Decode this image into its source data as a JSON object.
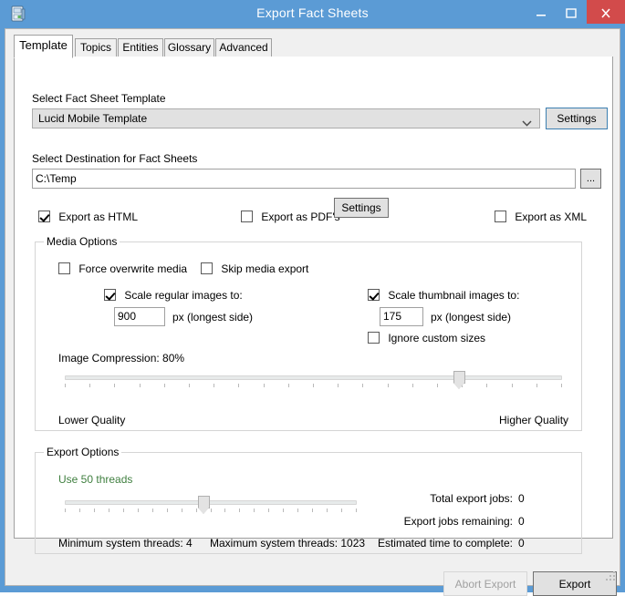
{
  "window": {
    "title": "Export Fact Sheets",
    "icon": "export-fact-sheets-icon",
    "minimize_label": "–",
    "maximize_label": "☐",
    "close_label": "✕",
    "accent_color": "#5b9bd5",
    "close_color": "#d24b4b"
  },
  "tabs": [
    {
      "label": "Template",
      "active": true
    },
    {
      "label": "Topics",
      "active": false
    },
    {
      "label": "Entities",
      "active": false
    },
    {
      "label": "Glossary",
      "active": false
    },
    {
      "label": "Advanced",
      "active": false
    }
  ],
  "template_tab": {
    "template_section": {
      "label": "Select Fact Sheet Template",
      "combo_value": "Lucid Mobile Template",
      "settings_label": "Settings"
    },
    "destination_section": {
      "label": "Select Destination for Fact Sheets",
      "value": "C:\\Temp",
      "browse_label": "..."
    },
    "format_options": [
      {
        "label": "Export as HTML",
        "checked": true
      },
      {
        "label": "Export as PDF's",
        "checked": false
      },
      {
        "label": "Export as XML",
        "checked": false
      }
    ],
    "pdf_settings_label": "Settings",
    "media_options": {
      "title": "Media Options",
      "force_overwrite": {
        "label": "Force overwrite media",
        "checked": false
      },
      "skip_media": {
        "label": "Skip media export",
        "checked": false
      },
      "scale_regular": {
        "label": "Scale regular images to:",
        "checked": true
      },
      "regular_value": "900",
      "regular_units": "px (longest side)",
      "scale_thumbnail": {
        "label": "Scale thumbnail images to:",
        "checked": true
      },
      "thumbnail_value": "175",
      "thumbnail_units": "px (longest side)",
      "ignore_custom": {
        "label": "Ignore custom sizes",
        "checked": false
      },
      "compression_label": "Image Compression: 80%",
      "compression_percent": 80,
      "quality_low": "Lower Quality",
      "quality_high": "Higher Quality"
    },
    "export_options": {
      "title": "Export Options",
      "threads_label": "Use 50 threads",
      "threads_color": "#3f7f3f",
      "min_threads_label": "Minimum system threads: 4",
      "max_threads_label": "Maximum system threads: 1023",
      "stats": [
        {
          "label": "Total export jobs:",
          "value": "0"
        },
        {
          "label": "Export jobs remaining:",
          "value": "0"
        },
        {
          "label": "Estimated time to complete:",
          "value": "0"
        }
      ]
    }
  },
  "footer": {
    "abort_label": "Abort Export",
    "export_label": "Export"
  }
}
